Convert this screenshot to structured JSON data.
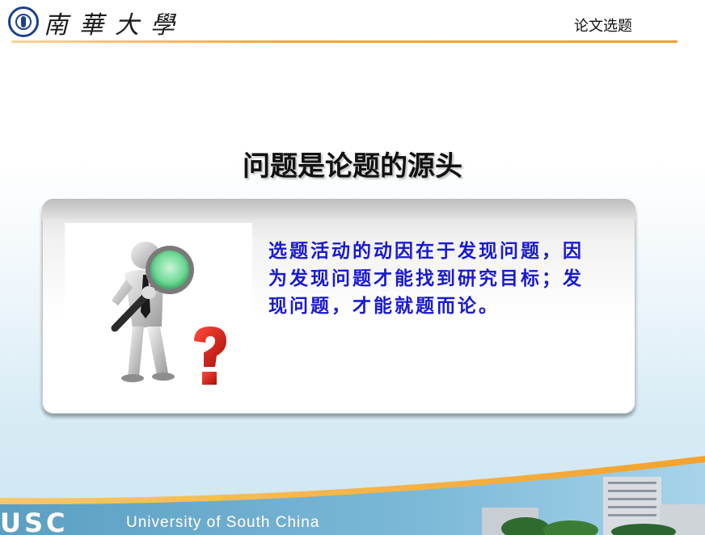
{
  "header": {
    "logo_text": "南華大學",
    "label": "论文选题"
  },
  "main": {
    "heading": "问题是论题的源头",
    "body_text": "选题活动的动因在于发现问题，因为发现问题才能找到研究目标；发现问题，才能就题而论。"
  },
  "footer": {
    "usc_mark": "USC",
    "university_name": "University of South China"
  },
  "icons": {
    "seal": "university-seal-icon",
    "figure": "magnifier-person-icon",
    "question": "question-mark-icon"
  },
  "colors": {
    "header_rule": "#f2a83a",
    "body_text": "#1a1ad0",
    "seal": "#1c3f8c"
  }
}
